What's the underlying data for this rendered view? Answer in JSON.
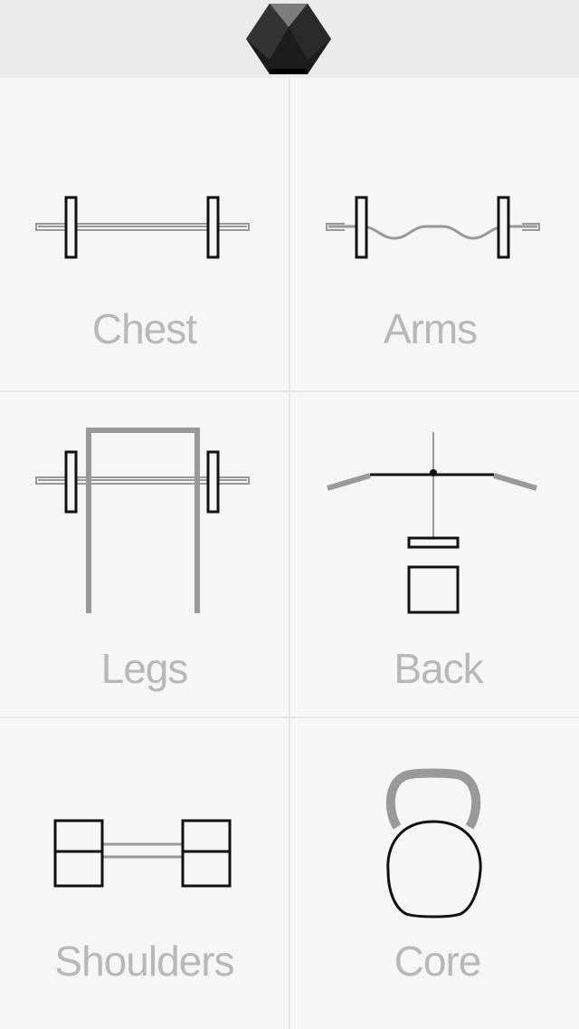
{
  "header": {
    "logo_icon": "hexagon-logo-icon"
  },
  "categories": [
    {
      "label": "Chest",
      "icon": "barbell-icon"
    },
    {
      "label": "Arms",
      "icon": "ez-curl-bar-icon"
    },
    {
      "label": "Legs",
      "icon": "squat-rack-icon"
    },
    {
      "label": "Back",
      "icon": "lat-pulldown-icon"
    },
    {
      "label": "Shoulders",
      "icon": "dumbbell-icon"
    },
    {
      "label": "Core",
      "icon": "kettlebell-icon"
    }
  ],
  "colors": {
    "background": "#f6f6f6",
    "header_background": "#ebebeb",
    "label_text": "#b8b8b8",
    "icon_dark": "#111111",
    "icon_gray": "#999999",
    "divider": "#e6e6e6"
  }
}
